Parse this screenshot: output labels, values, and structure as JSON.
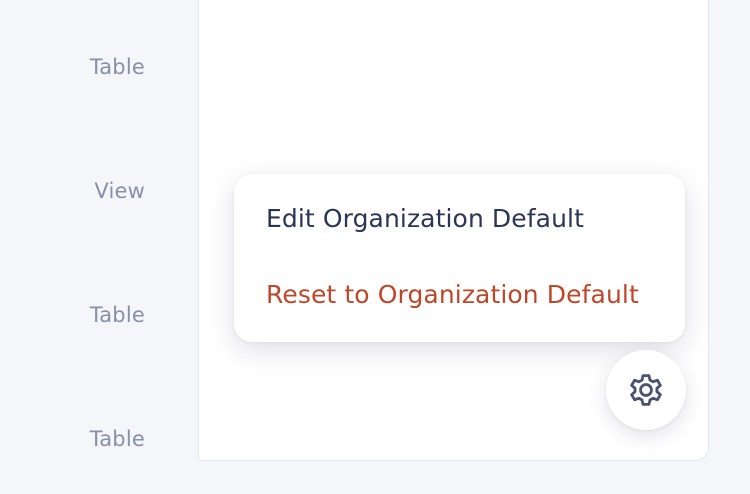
{
  "sidebar": {
    "type_labels": [
      "Table",
      "View",
      "Table",
      "Table"
    ]
  },
  "menu": {
    "items": [
      {
        "label": "Edit Organization Default"
      },
      {
        "label": "Reset to Organization Default"
      }
    ]
  },
  "settings_button": {
    "icon": "gear-icon"
  },
  "colors": {
    "background": "#f5f6fa",
    "card": "#ffffff",
    "muted_text": "#8a8fa8",
    "primary_text": "#2d3556",
    "danger_text": "#bf4728",
    "icon": "#4a5270"
  }
}
